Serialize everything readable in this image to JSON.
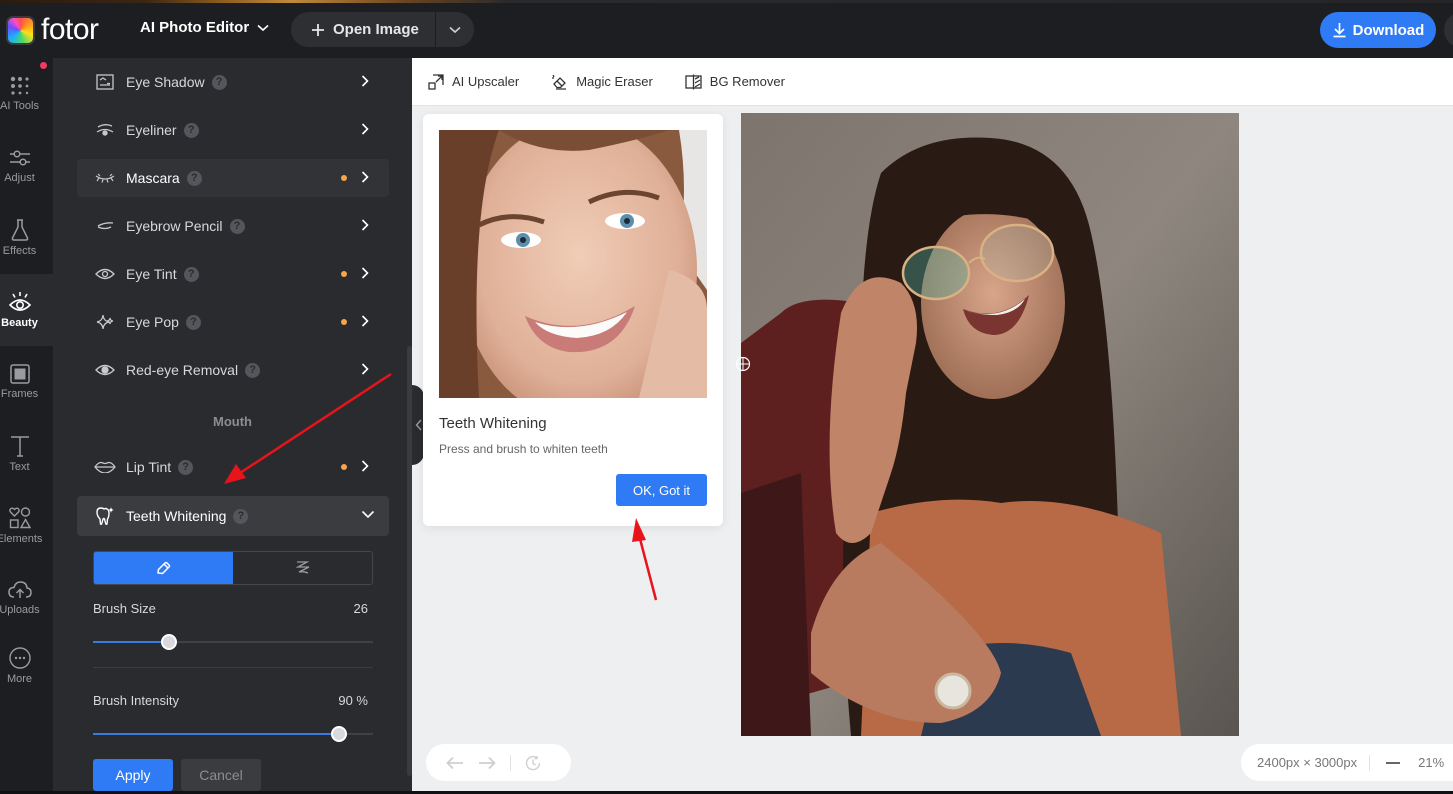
{
  "header": {
    "logo_text": "fotor",
    "product_menu_label": "AI Photo Editor",
    "open_image_label": "Open Image",
    "download_label": "Download"
  },
  "rail": {
    "items": [
      {
        "label": "AI Tools",
        "icon": "grid-dots-icon",
        "has_notification": true
      },
      {
        "label": "Adjust",
        "icon": "sliders-icon"
      },
      {
        "label": "Effects",
        "icon": "flask-icon"
      },
      {
        "label": "Beauty",
        "icon": "eye-lashes-icon",
        "active": true
      },
      {
        "label": "Frames",
        "icon": "frame-icon"
      },
      {
        "label": "Text",
        "icon": "text-icon"
      },
      {
        "label": "Elements",
        "icon": "shapes-icon"
      },
      {
        "label": "Uploads",
        "icon": "cloud-upload-icon"
      },
      {
        "label": "More",
        "icon": "more-icon"
      }
    ]
  },
  "panel": {
    "features": [
      {
        "label": "Eye Shadow",
        "icon": "eye-shadow-icon",
        "dot": false
      },
      {
        "label": "Eyeliner",
        "icon": "eyeliner-icon",
        "dot": false
      },
      {
        "label": "Mascara",
        "icon": "mascara-icon",
        "dot": true
      },
      {
        "label": "Eyebrow Pencil",
        "icon": "eyebrow-icon",
        "dot": false
      },
      {
        "label": "Eye Tint",
        "icon": "eye-icon",
        "dot": true
      },
      {
        "label": "Eye Pop",
        "icon": "sparkle-icon",
        "dot": true
      },
      {
        "label": "Red-eye Removal",
        "icon": "red-eye-icon",
        "dot": false
      }
    ],
    "mouth_section_label": "Mouth",
    "mouth_features": [
      {
        "label": "Lip Tint",
        "icon": "lips-icon",
        "dot": true
      },
      {
        "label": "Teeth Whitening",
        "icon": "tooth-icon",
        "expanded": true
      }
    ],
    "help_glyph": "?",
    "teeth_whitening": {
      "modes": [
        "brush",
        "erase"
      ],
      "active_mode": "brush",
      "brush_size_label": "Brush Size",
      "brush_size_value": "26",
      "brush_size_fraction": 0.27,
      "brush_intensity_label": "Brush Intensity",
      "brush_intensity_value": "90 %",
      "brush_intensity_fraction": 0.88,
      "apply_label": "Apply",
      "cancel_label": "Cancel"
    }
  },
  "toolbar": {
    "tools": [
      {
        "label": "AI Upscaler",
        "icon": "upscale-icon"
      },
      {
        "label": "Magic Eraser",
        "icon": "eraser-icon"
      },
      {
        "label": "BG Remover",
        "icon": "bg-remover-icon"
      }
    ]
  },
  "tip": {
    "title": "Teeth Whitening",
    "description": "Press and brush to whiten teeth",
    "ok_label": "OK, Got it"
  },
  "canvas": {
    "dimensions": "2400px × 3000px",
    "zoom": "21%"
  },
  "colors": {
    "accent": "#2f7bf5",
    "dot": "#f5a54a",
    "notification": "#f23a63",
    "annotation_arrow": "#e8141b"
  }
}
